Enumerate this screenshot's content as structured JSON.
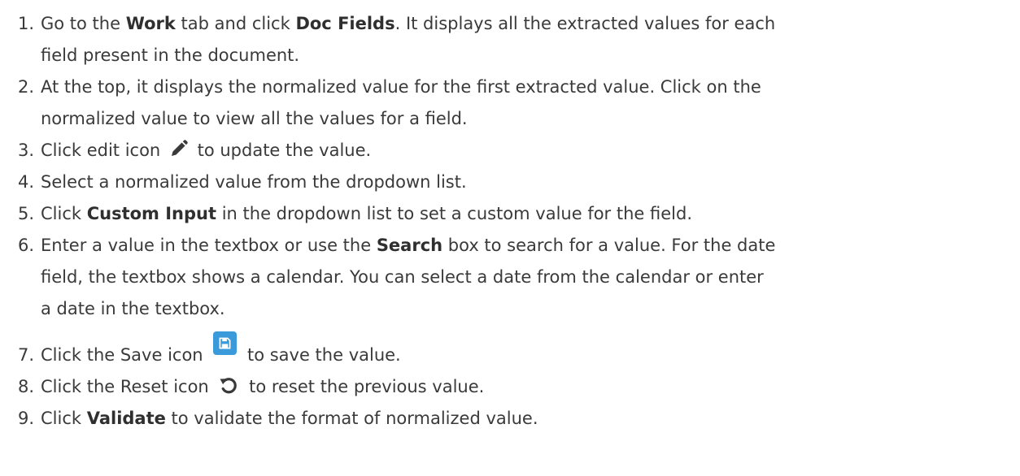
{
  "steps": [
    {
      "number": "1.",
      "line1_pre": "Go to the ",
      "b1": "Work",
      "line1_mid": " tab and click ",
      "b2": "Doc Fields",
      "line1_post": ". It displays all the extracted values for each",
      "line2": "field present in the document."
    },
    {
      "number": "2.",
      "line1": "At the top, it displays the normalized value for the first extracted value. Click on the",
      "line2": "normalized value to view all the values for a field."
    },
    {
      "number": "3.",
      "pre": "Click edit icon ",
      "icon": "pencil-icon",
      "post": " to update the value."
    },
    {
      "number": "4.",
      "text": "Select a normalized value from the dropdown list."
    },
    {
      "number": "5.",
      "pre": "Click ",
      "b1": "Custom Input",
      "post": " in the dropdown list to set a custom value for the field."
    },
    {
      "number": "6.",
      "line1_pre": "Enter a value in the textbox or use the ",
      "b1": "Search",
      "line1_post": " box to search for a value. For the date",
      "line2": "field, the textbox shows a calendar. You can select a date from the calendar or enter",
      "line3": "a date in the textbox."
    },
    {
      "number": "7.",
      "pre": "Click the Save icon ",
      "icon": "save-icon",
      "post": " to save the value."
    },
    {
      "number": "8.",
      "pre": "Click the Reset icon ",
      "icon": "reset-icon",
      "post": " to reset the previous value."
    },
    {
      "number": "9.",
      "pre": "Click ",
      "b1": "Validate",
      "post": " to validate the format of normalized value."
    }
  ],
  "colors": {
    "text": "#3a3a3a",
    "save_icon_bg": "#3b9ad9",
    "icon_dark": "#3a3a3a"
  }
}
